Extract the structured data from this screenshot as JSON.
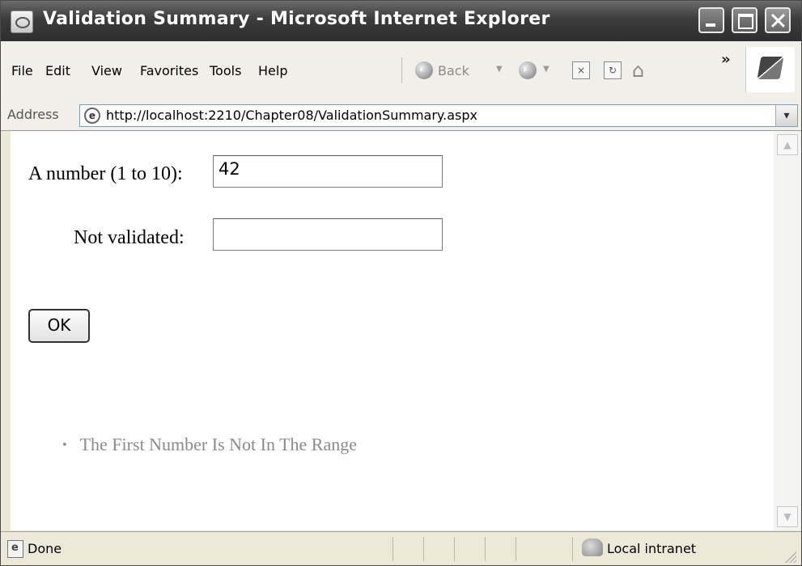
{
  "window": {
    "title": "Validation Summary - Microsoft Internet Explorer"
  },
  "menu": {
    "items": [
      "File",
      "Edit",
      "View",
      "Favorites",
      "Tools",
      "Help"
    ]
  },
  "toolbar": {
    "back_label": "Back",
    "back_icon": "back-arrow-icon",
    "forward_icon": "forward-arrow-icon",
    "stop_icon": "stop-icon",
    "refresh_icon": "refresh-icon",
    "home_icon": "home-icon",
    "more_glyph": "»"
  },
  "address": {
    "label": "Address",
    "url": "http://localhost:2210/Chapter08/ValidationSummary.aspx"
  },
  "form": {
    "number_label": "A number (1 to 10):",
    "number_value": "42",
    "notvalidated_label": "Not validated:",
    "notvalidated_value": "",
    "ok_label": "OK"
  },
  "validation_summary": {
    "items": [
      "The First Number Is Not In The Range"
    ]
  },
  "status": {
    "text": "Done",
    "zone": "Local intranet"
  }
}
